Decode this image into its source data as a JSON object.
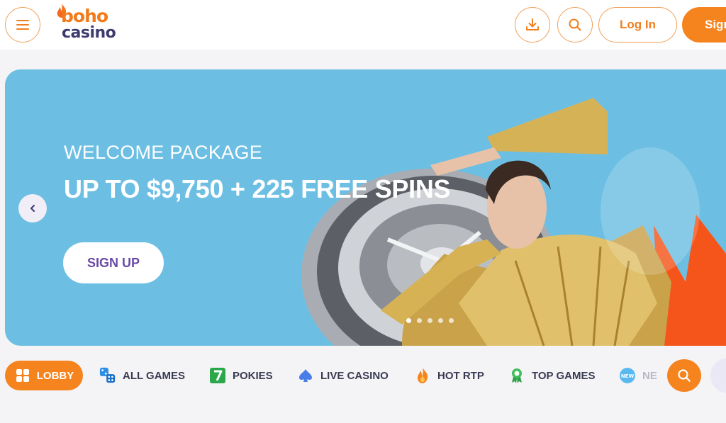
{
  "header": {
    "logo_top": "boho",
    "logo_bottom": "casino",
    "login_label": "Log In",
    "signup_label": "Sign",
    "menu_icon": "hamburger-icon",
    "download_icon": "download-icon",
    "search_icon": "search-icon"
  },
  "banner": {
    "subtitle": "WELCOME PACKAGE",
    "title": "UP TO $9,750 + 225 FREE SPINS",
    "cta_label": "SIGN UP",
    "prev_icon": "chevron-left-icon",
    "slide_count": 5,
    "active_slide": 1,
    "background_color": "#6cbfe3"
  },
  "categories": [
    {
      "label": "LOBBY",
      "icon": "grid-icon",
      "active": true
    },
    {
      "label": "ALL GAMES",
      "icon": "dice-icon",
      "active": false
    },
    {
      "label": "POKIES",
      "icon": "seven-icon",
      "active": false
    },
    {
      "label": "LIVE CASINO",
      "icon": "spade-icon",
      "active": false
    },
    {
      "label": "HOT RTP",
      "icon": "flame-icon",
      "active": false
    },
    {
      "label": "TOP GAMES",
      "icon": "award-icon",
      "active": false
    },
    {
      "label": "NE",
      "icon": "new-badge-icon",
      "active": false
    }
  ],
  "colors": {
    "accent": "#f5841f",
    "brand_dark": "#3d3a6e",
    "cta_text": "#6a4aa8"
  }
}
